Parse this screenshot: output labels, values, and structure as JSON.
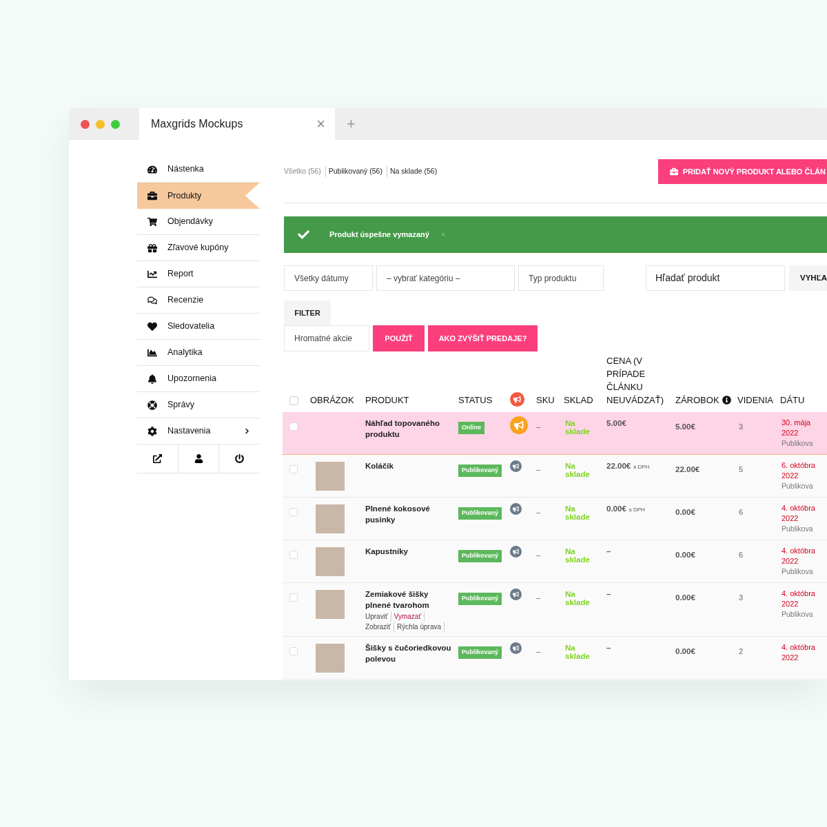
{
  "window": {
    "tab_title": "Maxgrids Mockups",
    "close": "×",
    "new_tab": "+"
  },
  "sidebar": {
    "items": [
      {
        "label": "Nástenka",
        "selected": false,
        "has_submenu": false
      },
      {
        "label": "Produkty",
        "selected": true,
        "has_submenu": false
      },
      {
        "label": "Objendávky",
        "selected": false,
        "has_submenu": false
      },
      {
        "label": "Zľavové kupóny",
        "selected": false,
        "has_submenu": false
      },
      {
        "label": "Report",
        "selected": false,
        "has_submenu": false
      },
      {
        "label": "Recenzie",
        "selected": false,
        "has_submenu": false
      },
      {
        "label": "Sledovatelia",
        "selected": false,
        "has_submenu": false
      },
      {
        "label": "Analytika",
        "selected": false,
        "has_submenu": false
      },
      {
        "label": "Upozornenia",
        "selected": false,
        "has_submenu": false
      },
      {
        "label": "Správy",
        "selected": false,
        "has_submenu": false
      },
      {
        "label": "Nastavenia",
        "selected": false,
        "has_submenu": true
      }
    ]
  },
  "filter_links": [
    {
      "label": "Všetko (56)",
      "selected": true
    },
    {
      "label": "Publikovaný (56)",
      "selected": false
    },
    {
      "label": "Na sklade (56)",
      "selected": false
    }
  ],
  "add_button": "PRIDAŤ NOVÝ PRODUKT ALEBO ČLÁN",
  "notice": {
    "text": "Produkt úspešne vymazaný",
    "close": "×"
  },
  "filters": {
    "date": "Všetky dátumy",
    "category": "– vybrať kategóriu –",
    "type": "Typ produktu",
    "search_placeholder": "Hľadať produkt",
    "search_button": "VYHĽA",
    "filter_button": "FILTER"
  },
  "bulk": {
    "placeholder": "Hromatné akcie",
    "apply": "POUŽIŤ",
    "promo": "AKO ZVÝŠIŤ PREDAJE?"
  },
  "table": {
    "select_all_checked": false,
    "columns": [
      "OBRÁZOK",
      "PRODUKT",
      "STATUS",
      "SKU",
      "SKLAD",
      "CENA (V PRÍPADE ČLÁNKU NEUVÁDZAŤ)",
      "ZÁROBOK",
      "VIDENIA",
      "DÁTU"
    ],
    "rows": [
      {
        "highlighted": true,
        "checked": false,
        "image": false,
        "name": "Náhľad topovaného produktu",
        "status": "Online",
        "promoted": true,
        "sku": "–",
        "stock": "Na sklade",
        "price": "5.00€",
        "price_suffix": "",
        "earnings": "5.00€",
        "views": "3",
        "date": "30. mája 2022",
        "date_status": "Publikova",
        "actions": []
      },
      {
        "highlighted": false,
        "checked": false,
        "image": true,
        "name": "Koláčik",
        "status": "Publikovaný",
        "promoted": false,
        "sku": "–",
        "stock": "Na sklade",
        "price": "22.00€",
        "price_suffix": "s DPH",
        "earnings": "22.00€",
        "views": "5",
        "date": "6. októbra 2022",
        "date_status": "Publikova",
        "actions": []
      },
      {
        "highlighted": false,
        "checked": false,
        "image": true,
        "name": "Plnené kokosové pusinky",
        "status": "Publikovaný",
        "promoted": false,
        "sku": "–",
        "stock": "Na sklade",
        "price": "0.00€",
        "price_suffix": "s DPH",
        "earnings": "0.00€",
        "views": "6",
        "date": "4. októbra 2022",
        "date_status": "Publikova",
        "actions": []
      },
      {
        "highlighted": false,
        "checked": false,
        "image": true,
        "name": "Kapustníky",
        "status": "Publikovaný",
        "promoted": false,
        "sku": "–",
        "stock": "Na sklade",
        "price": "–",
        "price_suffix": "",
        "earnings": "0.00€",
        "views": "6",
        "date": "4. októbra 2022",
        "date_status": "Publikova",
        "actions": []
      },
      {
        "highlighted": false,
        "checked": false,
        "image": true,
        "name": "Zemiakové šišky plnené tvarohom",
        "status": "Publikovaný",
        "promoted": false,
        "sku": "–",
        "stock": "Na sklade",
        "price": "–",
        "price_suffix": "",
        "earnings": "0.00€",
        "views": "3",
        "date": "4. októbra 2022",
        "date_status": "Publikova",
        "actions": [
          {
            "label": "Upraviť",
            "kind": "normal"
          },
          {
            "label": "Vymazať",
            "kind": "danger"
          },
          {
            "label": "Zobraziť",
            "kind": "normal"
          },
          {
            "label": "Rýchla úprava",
            "kind": "normal"
          }
        ]
      },
      {
        "highlighted": false,
        "checked": false,
        "image": true,
        "name": "Šišky s čučoriedkovou polevou",
        "status": "Publikovaný",
        "promoted": false,
        "sku": "–",
        "stock": "Na sklade",
        "price": "–",
        "price_suffix": "",
        "earnings": "0.00€",
        "views": "2",
        "date": "4. októbra 2022",
        "date_status": "",
        "actions": []
      }
    ]
  }
}
